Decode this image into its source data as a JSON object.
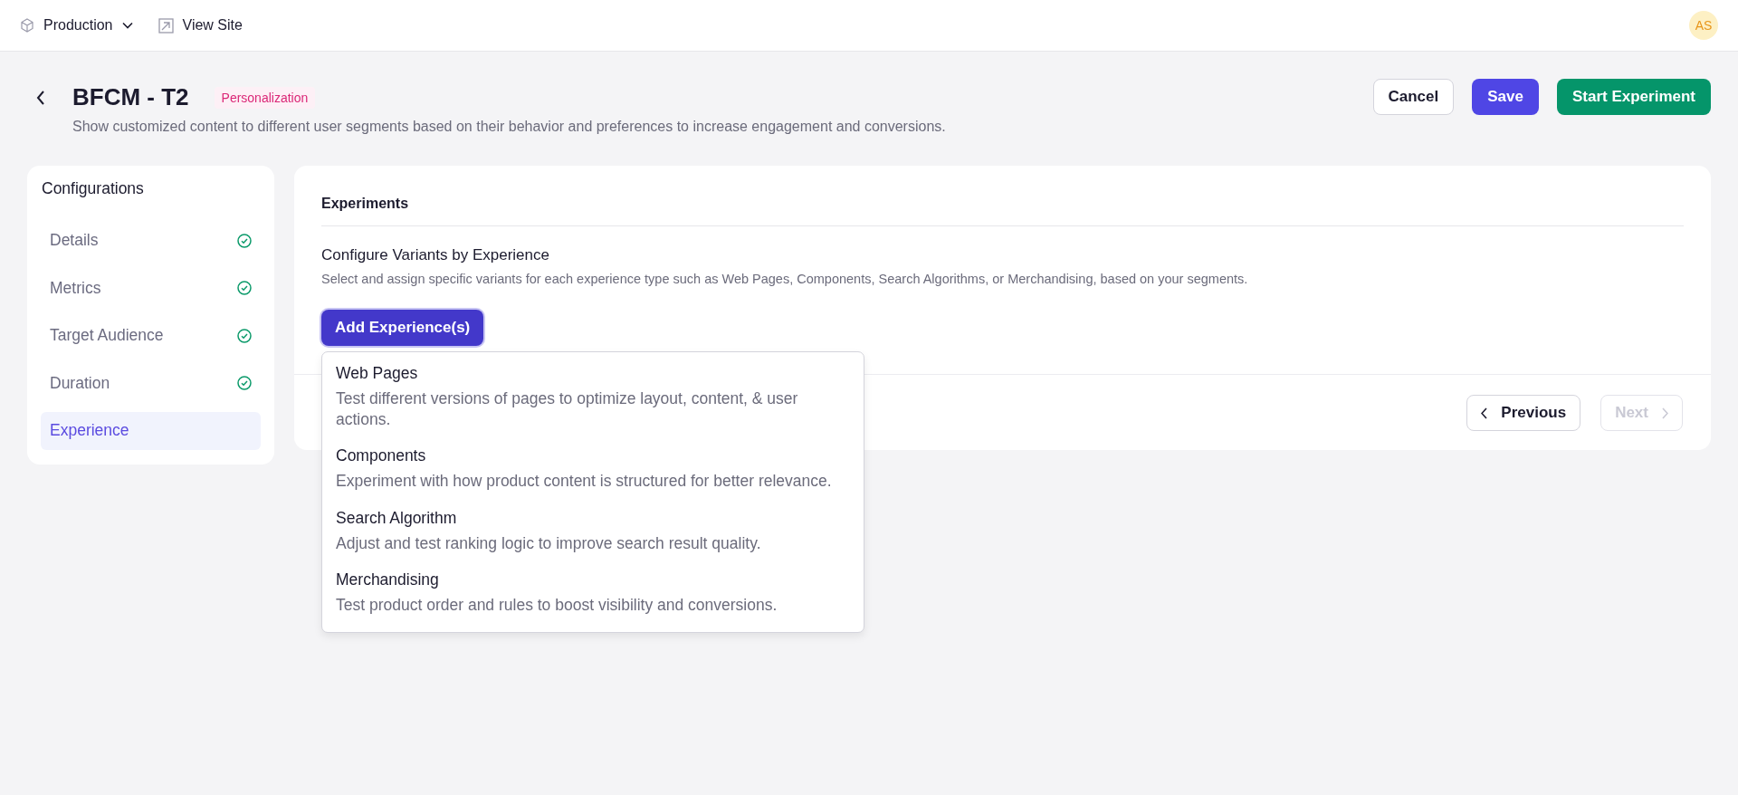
{
  "topbar": {
    "environment": "Production",
    "view_site": "View Site",
    "avatar": "AS"
  },
  "header": {
    "title": "BFCM - T2",
    "tag": "Personalization",
    "description": "Show customized content to different user segments based on their behavior and preferences to increase engagement and conversions.",
    "buttons": [
      {
        "label": "Cancel",
        "kind": "outline"
      },
      {
        "label": "Save",
        "kind": "primary"
      },
      {
        "label": "Start Experiment",
        "kind": "success"
      }
    ]
  },
  "sidebar": {
    "title": "Configurations",
    "items": [
      {
        "label": "Details",
        "completed": true,
        "selected": false
      },
      {
        "label": "Metrics",
        "completed": true,
        "selected": false
      },
      {
        "label": "Target Audience",
        "completed": true,
        "selected": false
      },
      {
        "label": "Duration",
        "completed": true,
        "selected": false
      },
      {
        "label": "Experience",
        "completed": false,
        "selected": true
      }
    ]
  },
  "main": {
    "title": "Experiments",
    "section_title": "Configure Variants by Experience",
    "section_description": "Select and assign specific variants for each experience type such as Web Pages, Components, Search Algorithms, or Merchandising, based on your segments.",
    "add_button": "Add Experience(s)",
    "menu": [
      {
        "title": "Web Pages",
        "description": "Test different versions of pages to optimize layout, content, & user actions."
      },
      {
        "title": "Components",
        "description": "Experiment with how product content is structured for better relevance."
      },
      {
        "title": "Search Algorithm",
        "description": "Adjust and test ranking logic to improve search result quality."
      },
      {
        "title": "Merchandising",
        "description": "Test product order and rules to boost visibility and conversions."
      }
    ],
    "previous": {
      "label": "Previous",
      "disabled": false
    },
    "next": {
      "label": "Next",
      "disabled": true
    }
  }
}
